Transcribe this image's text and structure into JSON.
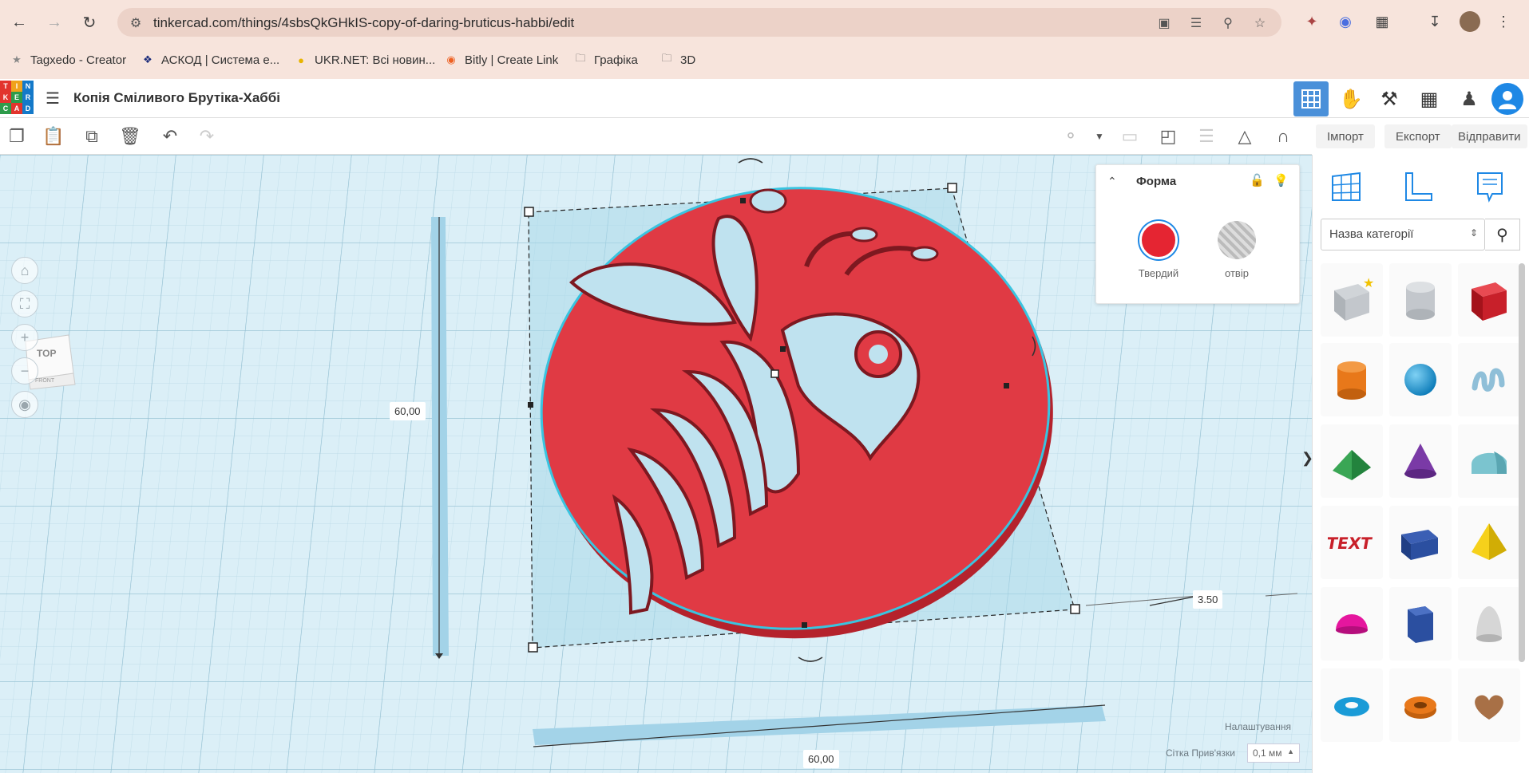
{
  "browser": {
    "url": "tinkercad.com/things/4sbsQkGHkIS-copy-of-daring-bruticus-habbi/edit",
    "bookmarks": [
      {
        "label": "Tagxedo - Creator",
        "icon": "star-icon"
      },
      {
        "label": "АСКОД | Система е...",
        "icon": "askod-icon"
      },
      {
        "label": "UKR.NET: Всі новин...",
        "icon": "ukrnet-icon"
      },
      {
        "label": "Bitly | Create Link",
        "icon": "bitly-icon"
      },
      {
        "label": "Графіка",
        "icon": "folder-icon"
      },
      {
        "label": "3D",
        "icon": "folder-icon"
      }
    ]
  },
  "header": {
    "logo_letters": [
      "T",
      "I",
      "N",
      "K",
      "E",
      "R",
      "C",
      "A",
      "D"
    ],
    "title": "Копія Сміливого Брутіка-Хаббі"
  },
  "toolbar": {
    "import_label": "Імпорт",
    "export_label": "Експорт",
    "send_label": "Відправити"
  },
  "view_cube": {
    "top_label": "TOP",
    "front_label": "FRONT"
  },
  "shape_panel": {
    "title": "Форма",
    "solid_label": "Твердий",
    "hole_label": "отвір",
    "solid_color": "#e52532"
  },
  "dimensions": {
    "height": "60,00",
    "width": "60,00",
    "elevation": "3.50"
  },
  "right_panel": {
    "category_label": "Назва категорії"
  },
  "footer": {
    "settings_label": "Налаштування",
    "grid_label": "Сітка Прив'язки",
    "grid_value": "0,1 мм"
  },
  "colors": {
    "accent": "#1e88e5",
    "shape_red": "#e03a44",
    "workplane": "#dbeff7"
  }
}
